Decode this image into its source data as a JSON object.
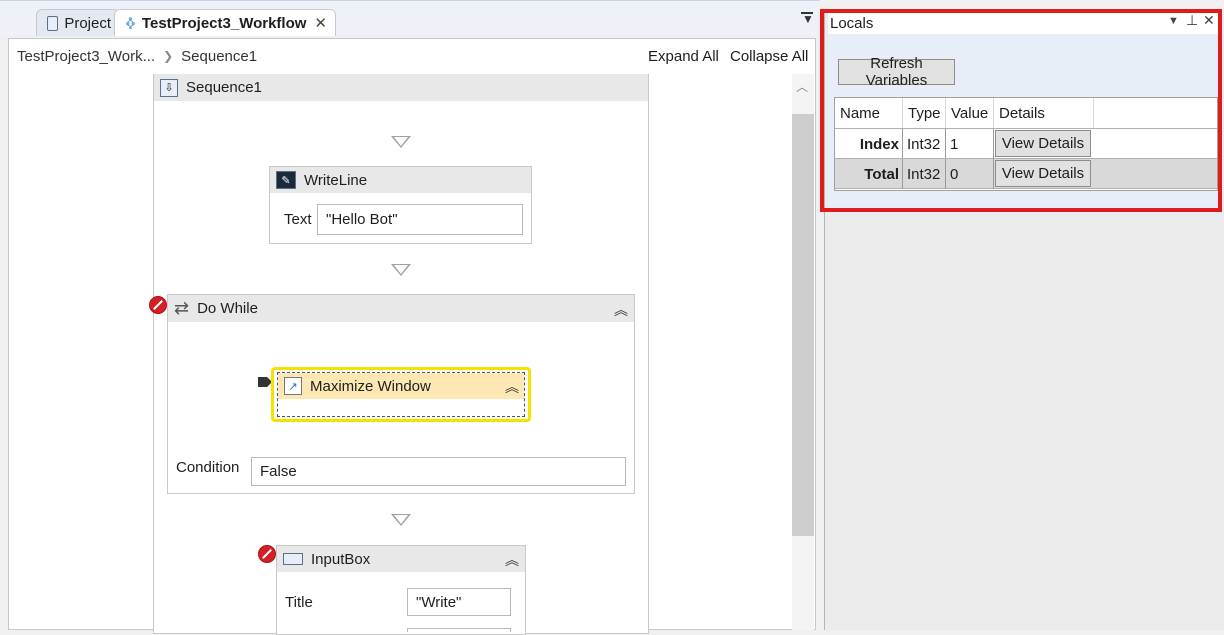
{
  "tabs": [
    {
      "label": "Project",
      "icon": "project-icon"
    },
    {
      "label": "TestProject3_Workflow",
      "icon": "workflow-icon",
      "active": true
    }
  ],
  "breadcrumb": {
    "items": [
      "TestProject3_Work...",
      "Sequence1"
    ]
  },
  "toolbar": {
    "expand_all": "Expand All",
    "collapse_all": "Collapse All"
  },
  "sequence": {
    "title": "Sequence1"
  },
  "writeline": {
    "title": "WriteLine",
    "text_label": "Text",
    "text_value": "\"Hello Bot\""
  },
  "dowhile": {
    "title": "Do While",
    "condition_label": "Condition",
    "condition_value": "False"
  },
  "maximize": {
    "title": "Maximize Window"
  },
  "inputbox": {
    "title": "InputBox",
    "title_label": "Title",
    "title_value": "\"Write\""
  },
  "locals": {
    "title": "Locals",
    "refresh_label": "Refresh Variables",
    "columns": [
      "Name",
      "Type",
      "Value",
      "Details"
    ],
    "rows": [
      {
        "name": "Index",
        "type": "Int32",
        "value": "1",
        "details": "View Details"
      },
      {
        "name": "Total",
        "type": "Int32",
        "value": "0",
        "details": "View Details"
      }
    ]
  },
  "colors": {
    "highlight": "#e01b1b",
    "selection": "#fde8b4",
    "selection_border": "#f3e400",
    "error": "#d51f26"
  }
}
